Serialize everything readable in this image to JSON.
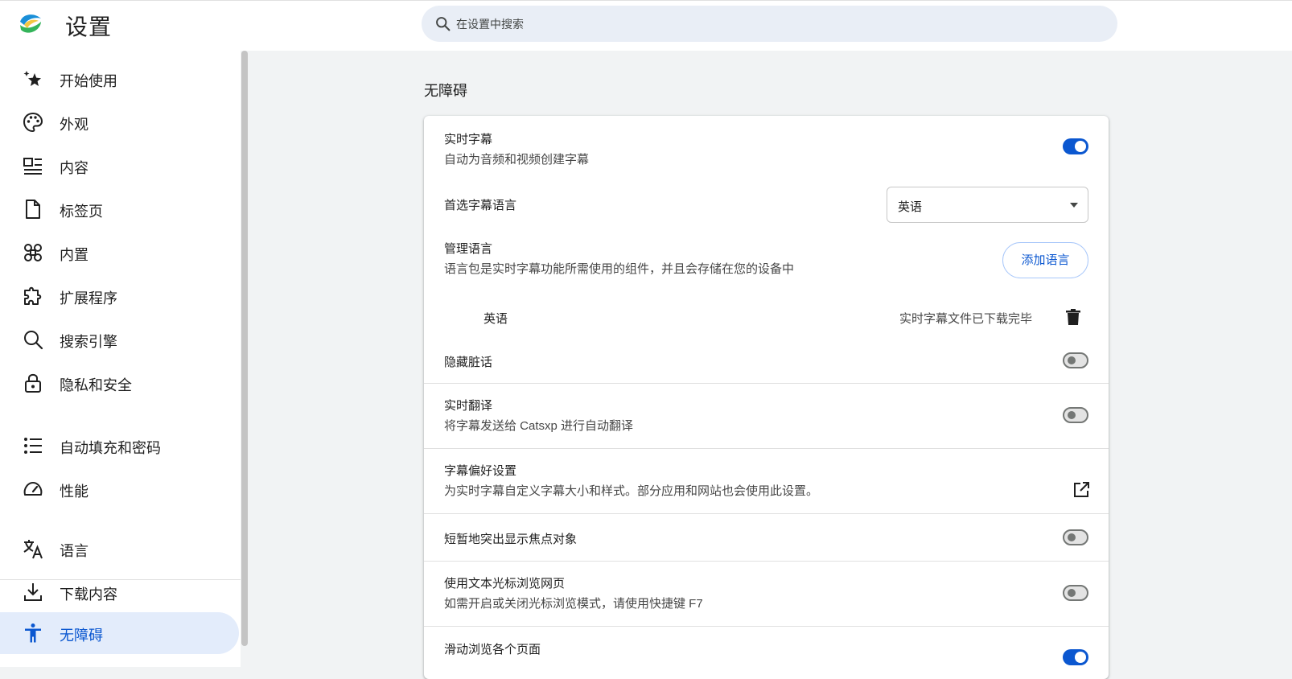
{
  "header": {
    "title": "设置",
    "search_placeholder": "在设置中搜索"
  },
  "colors": {
    "accent": "#0b57d0",
    "active_bg": "#e3ecfb",
    "page_bg": "#f1f3f4"
  },
  "sidebar": {
    "items": [
      {
        "label": "开始使用",
        "icon": "sparkle-star-icon"
      },
      {
        "label": "外观",
        "icon": "palette-icon"
      },
      {
        "label": "内容",
        "icon": "article-icon"
      },
      {
        "label": "标签页",
        "icon": "document-icon"
      },
      {
        "label": "内置",
        "icon": "command-key-icon"
      },
      {
        "label": "扩展程序",
        "icon": "puzzle-icon"
      },
      {
        "label": "搜索引擎",
        "icon": "search-icon"
      },
      {
        "label": "隐私和安全",
        "icon": "lock-icon"
      },
      {
        "label": "自动填充和密码",
        "icon": "checklist-icon"
      },
      {
        "label": "性能",
        "icon": "speedometer-icon"
      },
      {
        "label": "语言",
        "icon": "translate-icon"
      },
      {
        "label": "下载内容",
        "icon": "download-icon"
      },
      {
        "label": "无障碍",
        "icon": "accessibility-icon",
        "active": true
      }
    ]
  },
  "main": {
    "section_title": "无障碍",
    "live_caption": {
      "title": "实时字幕",
      "desc": "自动为音频和视频创建字幕",
      "enabled": true
    },
    "caption_language": {
      "title": "首选字幕语言",
      "selected": "英语"
    },
    "manage_languages": {
      "title": "管理语言",
      "desc": "语言包是实时字幕功能所需使用的组件，并且会存储在您的设备中",
      "add_button": "添加语言",
      "entry_name": "英语",
      "entry_status": "实时字幕文件已下载完毕"
    },
    "hide_profanity": {
      "title": "隐藏脏话",
      "enabled": false
    },
    "live_translate": {
      "title": "实时翻译",
      "desc": "将字幕发送给 Catsxp 进行自动翻译",
      "enabled": false
    },
    "caption_prefs": {
      "title": "字幕偏好设置",
      "desc": "为实时字幕自定义字幕大小和样式。部分应用和网站也会使用此设置。"
    },
    "focus_highlight": {
      "title": "短暂地突出显示焦点对象",
      "enabled": false
    },
    "caret_browsing": {
      "title": "使用文本光标浏览网页",
      "desc": "如需开启或关闭光标浏览模式，请使用快捷键 F7",
      "enabled": false
    },
    "swipe_navigation": {
      "title": "滑动浏览各个页面",
      "enabled": true
    }
  }
}
